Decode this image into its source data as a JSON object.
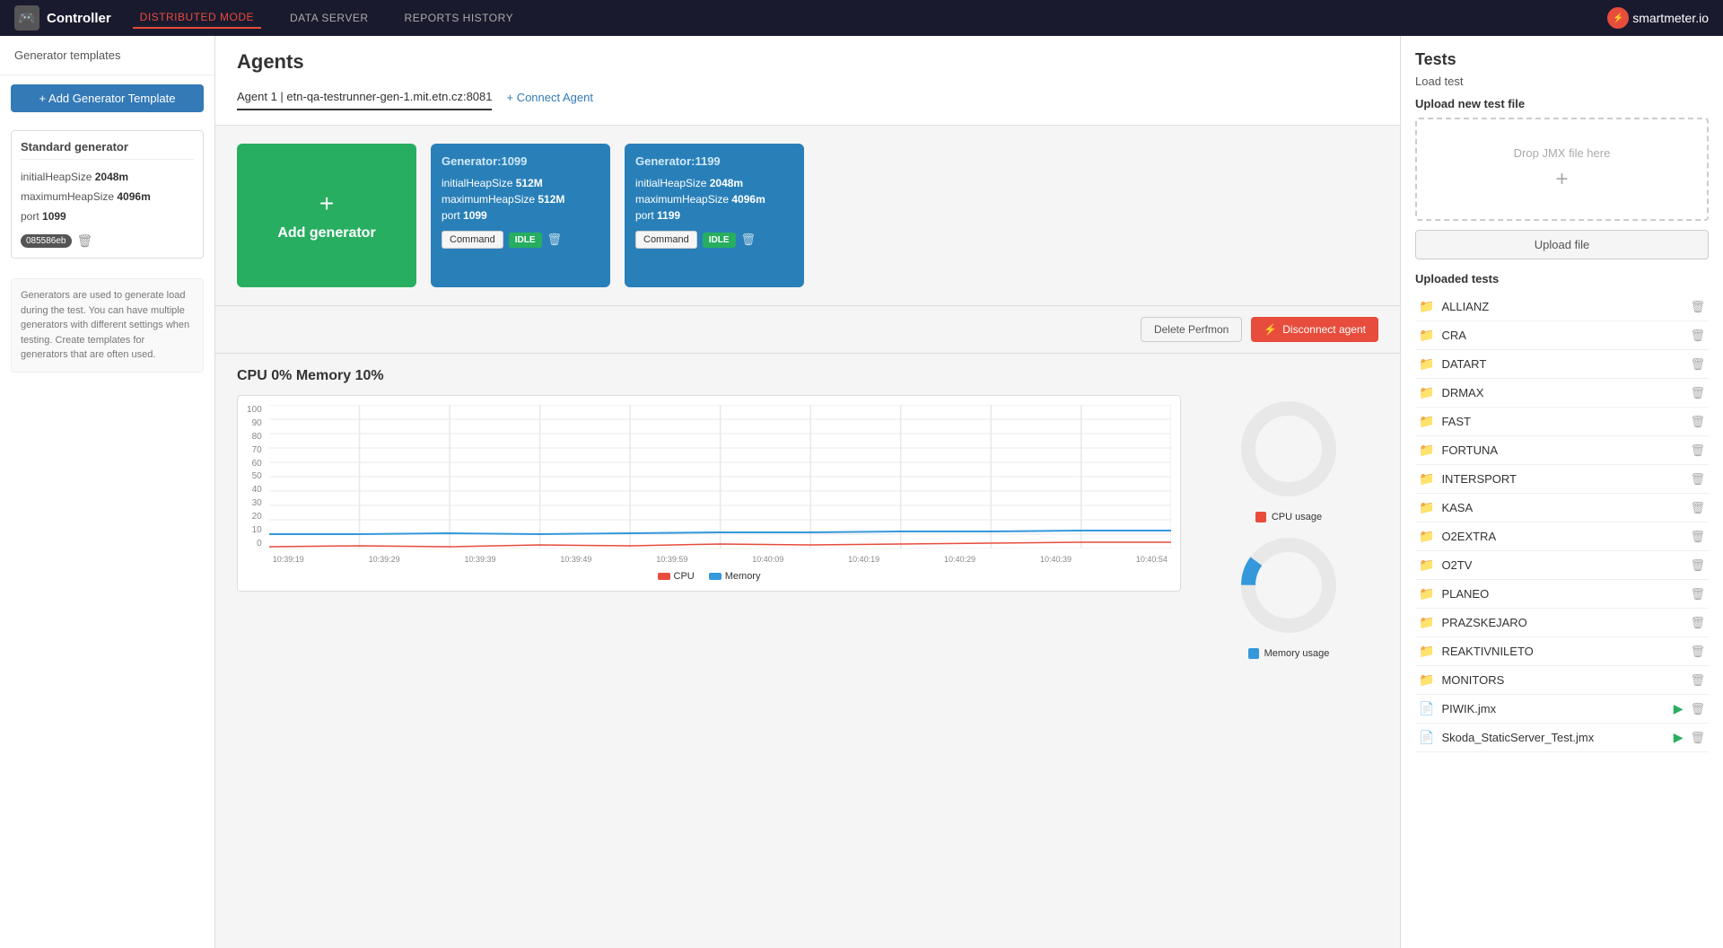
{
  "topnav": {
    "brand": "Controller",
    "modes": [
      {
        "label": "DISTRIBUTED MODE",
        "active": true
      },
      {
        "label": "DATA SERVER",
        "active": false
      },
      {
        "label": "REPORTS HISTORY",
        "active": false
      }
    ],
    "logo": "smartmeter.io"
  },
  "sidebar": {
    "header": "Generator templates",
    "add_button": "+ Add Generator Template",
    "standard_generator": {
      "title": "Standard generator",
      "props": [
        {
          "key": "initialHeapSize",
          "value": "2048m"
        },
        {
          "key": "maximumHeapSize",
          "value": "4096m"
        },
        {
          "key": "port",
          "value": "1099"
        }
      ],
      "hash": "085586eb"
    },
    "info_text": "Generators are used to generate load during the test. You can have multiple generators with different settings when testing. Create templates for generators that are often used."
  },
  "agents": {
    "title": "Agents",
    "active_agent": "Agent 1 | etn-qa-testrunner-gen-1.mit.etn.cz:8081",
    "connect_btn": "+ Connect Agent",
    "generators": [
      {
        "type": "add",
        "label": "Add generator"
      },
      {
        "id": "Generator:1099",
        "props": [
          {
            "key": "initialHeapSize",
            "value": "512M"
          },
          {
            "key": "maximumHeapSize",
            "value": "512M"
          },
          {
            "key": "port",
            "value": "1099"
          }
        ],
        "status": "IDLE",
        "command_label": "Command"
      },
      {
        "id": "Generator:1199",
        "props": [
          {
            "key": "initialHeapSize",
            "value": "2048m"
          },
          {
            "key": "maximumHeapSize",
            "value": "4096m"
          },
          {
            "key": "port",
            "value": "1199"
          }
        ],
        "status": "IDLE",
        "command_label": "Command"
      }
    ],
    "delete_perfmon_btn": "Delete Perfmon",
    "disconnect_agent_btn": "Disconnect agent"
  },
  "metrics": {
    "cpu_label": "CPU",
    "cpu_value": "0%",
    "memory_label": "Memory",
    "memory_value": "10%",
    "y_labels": [
      "100",
      "90",
      "80",
      "70",
      "60",
      "50",
      "40",
      "30",
      "20",
      "10",
      "0"
    ],
    "x_labels": [
      "10:39:19",
      "10:39:29",
      "10:39:39",
      "10:39:49",
      "10:39:59",
      "10:40:09",
      "10:40:19",
      "10:40:29",
      "10:40:39",
      "10:40:54"
    ],
    "legend_cpu": "CPU",
    "legend_memory": "Memory",
    "donut_cpu_label": "CPU usage",
    "donut_mem_label": "Memory usage"
  },
  "tests": {
    "title": "Tests",
    "load_test": "Load test",
    "upload_title": "Upload new test file",
    "drop_zone_text": "Drop JMX file here",
    "upload_btn": "Upload file",
    "uploaded_title": "Uploaded tests",
    "items": [
      {
        "name": "ALLIANZ",
        "type": "folder",
        "runnable": false
      },
      {
        "name": "CRA",
        "type": "folder",
        "runnable": false
      },
      {
        "name": "DATART",
        "type": "folder",
        "runnable": false
      },
      {
        "name": "DRMAX",
        "type": "folder",
        "runnable": false
      },
      {
        "name": "FAST",
        "type": "folder",
        "runnable": false
      },
      {
        "name": "FORTUNA",
        "type": "folder",
        "runnable": false
      },
      {
        "name": "INTERSPORT",
        "type": "folder",
        "runnable": false
      },
      {
        "name": "KASA",
        "type": "folder",
        "runnable": false
      },
      {
        "name": "O2EXTRA",
        "type": "folder",
        "runnable": false
      },
      {
        "name": "O2TV",
        "type": "folder",
        "runnable": false
      },
      {
        "name": "PLANEO",
        "type": "folder",
        "runnable": false
      },
      {
        "name": "PRAZSKEJARO",
        "type": "folder",
        "runnable": false
      },
      {
        "name": "REAKTIVNILETO",
        "type": "folder",
        "runnable": false
      },
      {
        "name": "MONITORS",
        "type": "folder",
        "runnable": false
      },
      {
        "name": "PIWIK.jmx",
        "type": "file",
        "runnable": true
      },
      {
        "name": "Skoda_StaticServer_Test.jmx",
        "type": "file",
        "runnable": true
      }
    ]
  }
}
